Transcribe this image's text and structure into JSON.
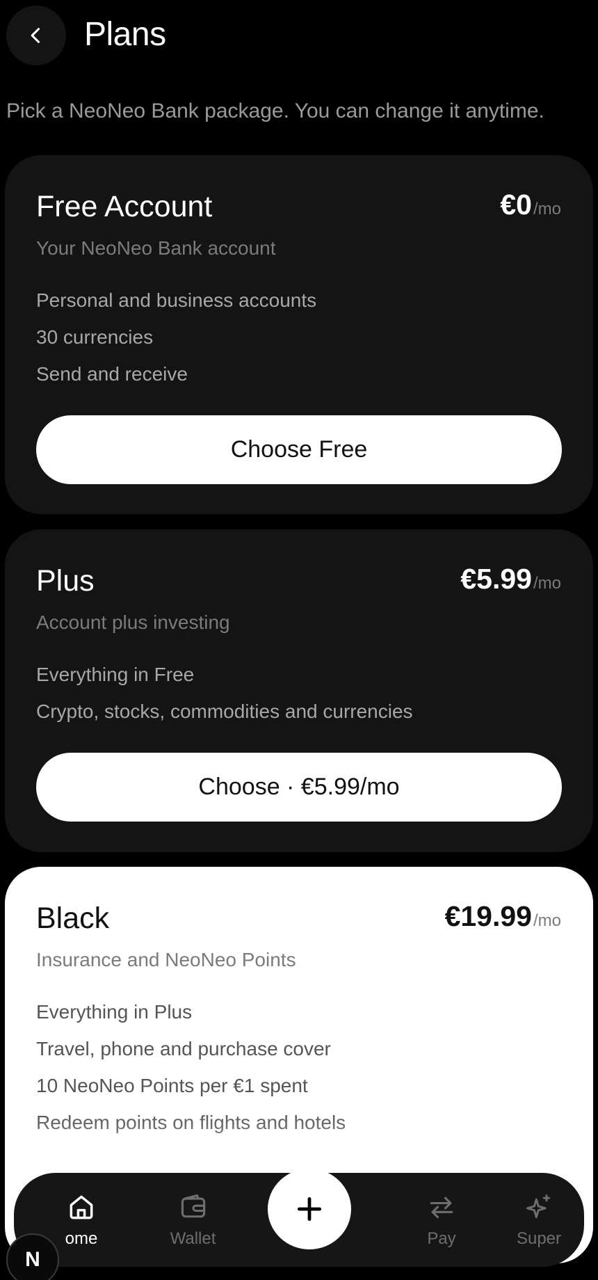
{
  "header": {
    "title": "Plans",
    "subtitle": "Pick a NeoNeo Bank package. You can change it anytime."
  },
  "plans": [
    {
      "name": "Free Account",
      "price": "€0",
      "period": "/mo",
      "tagline": "Your NeoNeo Bank account",
      "features": [
        "Personal and business accounts",
        "30 currencies",
        "Send and receive"
      ],
      "button": "Choose Free"
    },
    {
      "name": "Plus",
      "price": "€5.99",
      "period": "/mo",
      "tagline": "Account plus investing",
      "features": [
        "Everything in Free",
        "Crypto, stocks, commodities and currencies"
      ],
      "button": "Choose · €5.99/mo"
    },
    {
      "name": "Black",
      "price": "€19.99",
      "period": "/mo",
      "tagline": "Insurance and NeoNeo Points",
      "features": [
        "Everything in Plus",
        "Travel, phone and purchase cover",
        "10 NeoNeo Points per €1 spent",
        "Redeem points on flights and hotels"
      ]
    }
  ],
  "tabbar": {
    "home": "ome",
    "wallet": "Wallet",
    "pay": "Pay",
    "super": "Super"
  },
  "badge": "N",
  "icons": {
    "back": "chevron-left-icon",
    "home": "home-icon",
    "wallet": "wallet-icon",
    "add": "plus-icon",
    "pay": "transfer-arrows-icon",
    "super": "sparkles-icon"
  }
}
